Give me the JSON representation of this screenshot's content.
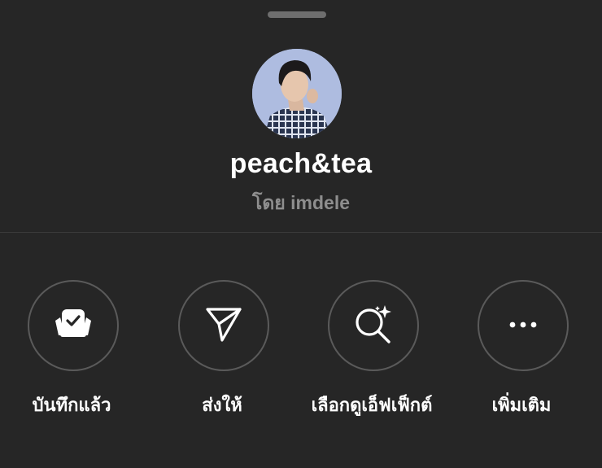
{
  "sheet": {
    "title": "peach&tea",
    "subtitle": "โดย imdele"
  },
  "actions": [
    {
      "label": "บันทึกแล้ว",
      "icon": "saved-collection-icon"
    },
    {
      "label": "ส่งให้",
      "icon": "send-paper-plane-icon"
    },
    {
      "label": "เลือกดูเอ็ฟเฟ็กต์",
      "icon": "browse-effects-sparkle-search-icon"
    },
    {
      "label": "เพิ่มเติม",
      "icon": "more-ellipsis-icon"
    }
  ],
  "colors": {
    "background": "#262626",
    "text_primary": "#ffffff",
    "text_secondary": "#8e8e8e",
    "circle_border": "#5a5a5a",
    "handle": "#6e6e6e"
  }
}
